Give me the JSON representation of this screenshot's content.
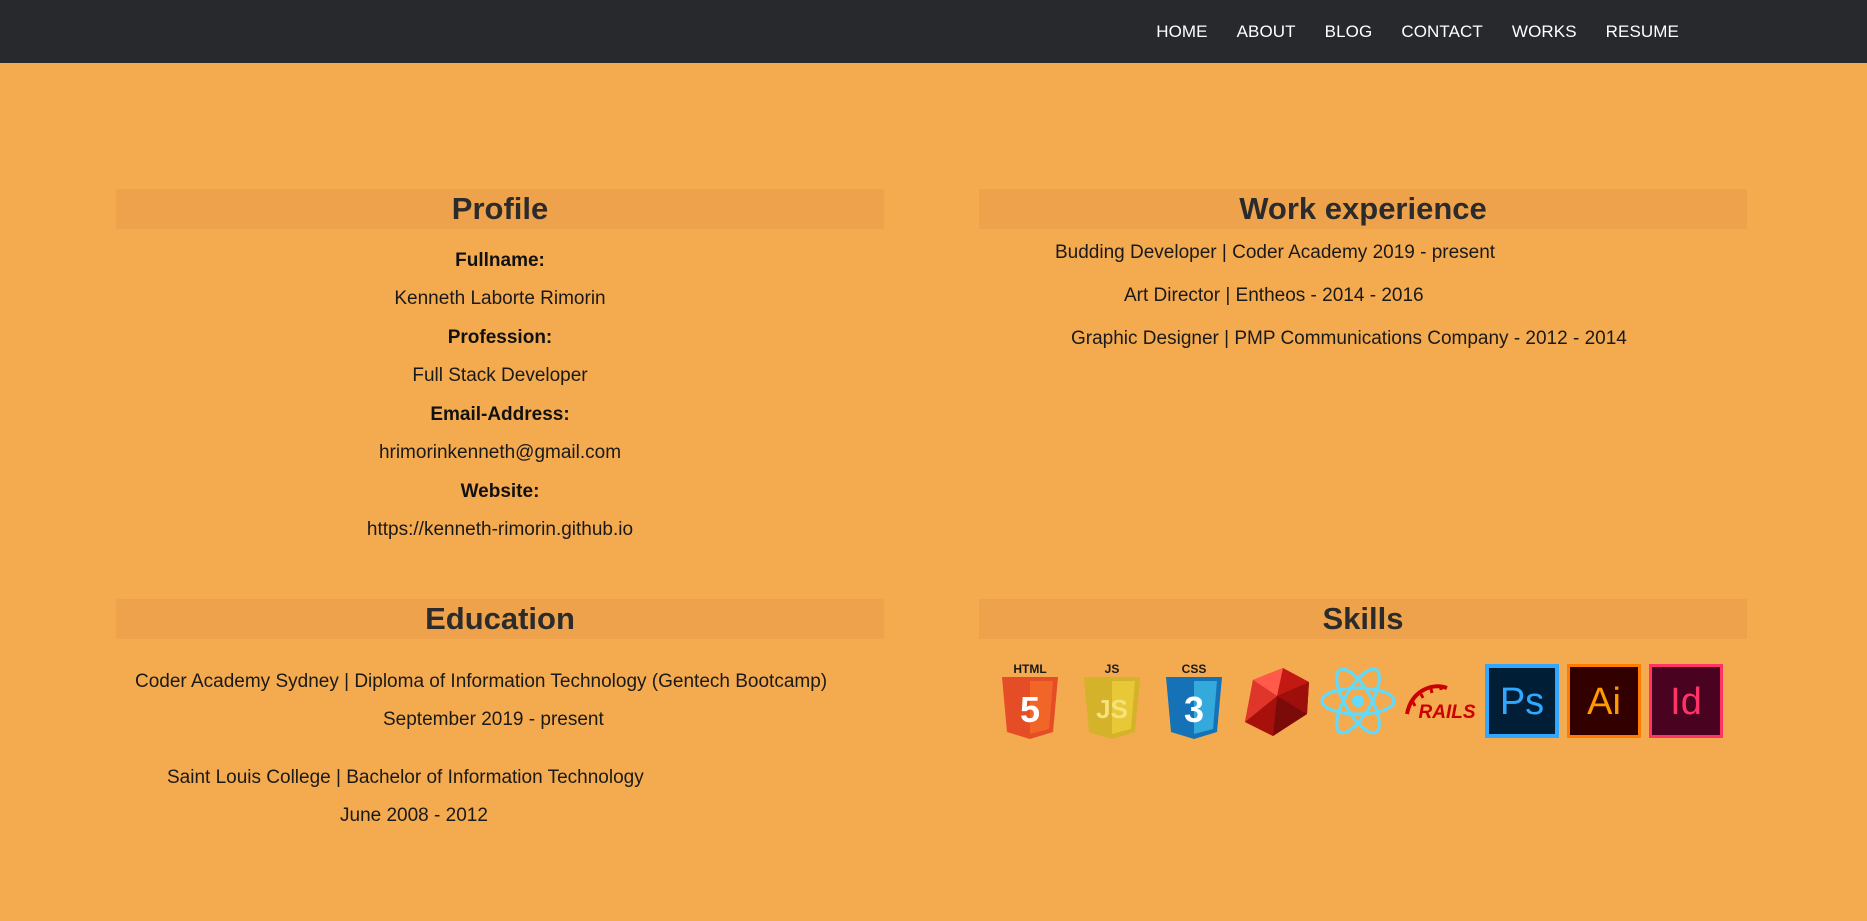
{
  "nav": {
    "items": [
      {
        "label": "HOME"
      },
      {
        "label": "ABOUT"
      },
      {
        "label": "BLOG"
      },
      {
        "label": "CONTACT"
      },
      {
        "label": "WORKS"
      },
      {
        "label": "RESUME"
      }
    ]
  },
  "profile": {
    "title": "Profile",
    "fields": [
      {
        "label": "Fullname:",
        "value": "Kenneth Laborte Rimorin"
      },
      {
        "label": "Profession:",
        "value": "Full Stack Developer"
      },
      {
        "label": "Email-Address:",
        "value": "hrimorinkenneth@gmail.com"
      },
      {
        "label": "Website:",
        "value": "https://kenneth-rimorin.github.io"
      }
    ]
  },
  "work": {
    "title": "Work experience",
    "items": [
      {
        "text": "Budding Developer | Coder Academy 2019 - present"
      },
      {
        "text": "Art Director | Entheos - 2014 - 2016"
      },
      {
        "text": "Graphic Designer | PMP Communications Company - 2012 - 2014"
      }
    ]
  },
  "education": {
    "title": "Education",
    "items": [
      {
        "school": "Coder Academy Sydney | Diploma of Information Technology (Gentech Bootcamp)",
        "dates": "September 2019 - present"
      },
      {
        "school": "Saint Louis College | Bachelor of Information Technology",
        "dates": "June 2008 - 2012"
      }
    ]
  },
  "skills": {
    "title": "Skills",
    "icons": [
      {
        "name": "html5-icon",
        "label": "HTML",
        "glyph": "5"
      },
      {
        "name": "javascript-icon",
        "label": "JS",
        "glyph": "JS"
      },
      {
        "name": "css3-icon",
        "label": "CSS",
        "glyph": "3"
      },
      {
        "name": "ruby-icon"
      },
      {
        "name": "react-icon"
      },
      {
        "name": "rails-icon",
        "label": "RAILS"
      },
      {
        "name": "photoshop-icon",
        "label": "Ps"
      },
      {
        "name": "illustrator-icon",
        "label": "Ai"
      },
      {
        "name": "indesign-icon",
        "label": "Id"
      }
    ]
  },
  "colors": {
    "page_bg": "#f4aa4e",
    "nav_bg": "#27292d",
    "section_header_bg": "#eea24b",
    "html5": "#e44d26",
    "javascript": "#d4b22a",
    "css3": "#1572b6",
    "ruby": "#c21913",
    "react": "#61dafb",
    "rails": "#cc0000",
    "photoshop": "#31a8ff",
    "illustrator": "#ff7c00",
    "indesign": "#ff3366"
  }
}
